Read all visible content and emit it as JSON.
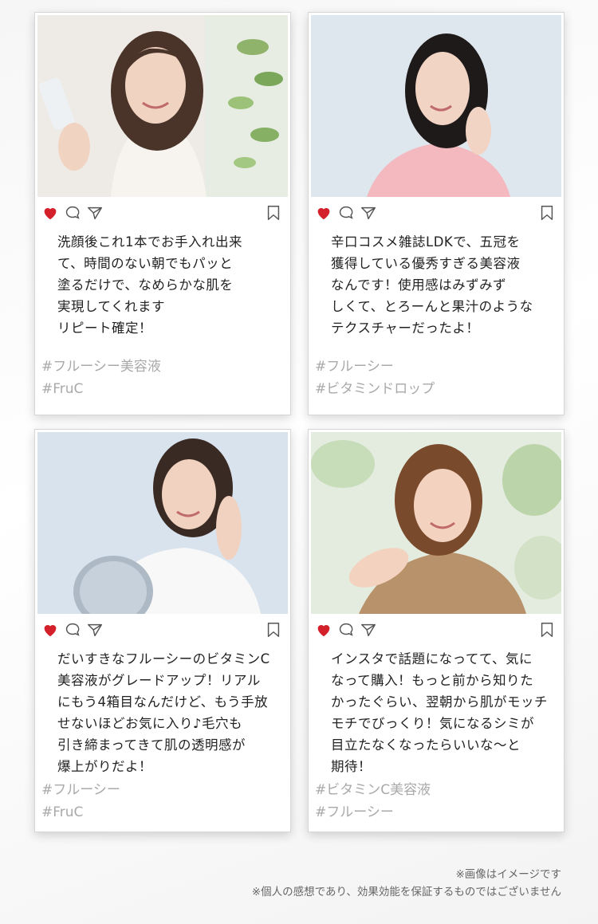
{
  "posts": [
    {
      "photo": "woman-with-smartphone-photo",
      "caption": "洗顔後これ1本でお手入れ出来\nて、時間のない朝でもパッと\n塗るだけで、なめらかな肌を\n実現してくれます\nリピート確定！",
      "tags": [
        "#フルーシー美容液",
        "#FruC"
      ]
    },
    {
      "photo": "woman-touching-cheek-photo",
      "caption": "辛口コスメ雑誌LDKで、五冠を\n獲得している優秀すぎる美容液\nなんです！使用感はみずみず\nしくて、とろーんと果汁のような\nテクスチャーだったよ！",
      "tags": [
        "#フルーシー",
        "#ビタミンドロップ"
      ]
    },
    {
      "photo": "woman-at-mirror-photo",
      "caption": "だいすきなフルーシーのビタミンC\n美容液がグレードアップ！リアル\nにもう4箱目なんだけど、もう手放\nせないほどお気に入り♪毛穴も\n引き締まってきて肌の透明感が\n爆上がりだよ！",
      "tags": [
        "#フルーシー",
        "#FruC"
      ]
    },
    {
      "photo": "woman-hand-on-shoulder-photo",
      "caption": "インスタで話題になってて、気に\nなって購入！もっと前から知りた\nかったぐらい、翌朝から肌がモッチ\nモチでびっくり！気になるシミが\n目立たなくなったらいいな〜と\n期待！",
      "tags": [
        "#ビタミンC美容液",
        "#フルーシー"
      ]
    }
  ],
  "icons": {
    "heart": "heart-icon",
    "comment": "comment-icon",
    "share": "share-icon",
    "bookmark": "bookmark-icon"
  },
  "colors": {
    "heart": "#d4202a",
    "tag": "#a9a9a9",
    "icon_outline": "#555555"
  },
  "notes": {
    "line1": "※画像はイメージです",
    "line2": "※個人の感想であり、効果効能を保証するものではございません"
  }
}
